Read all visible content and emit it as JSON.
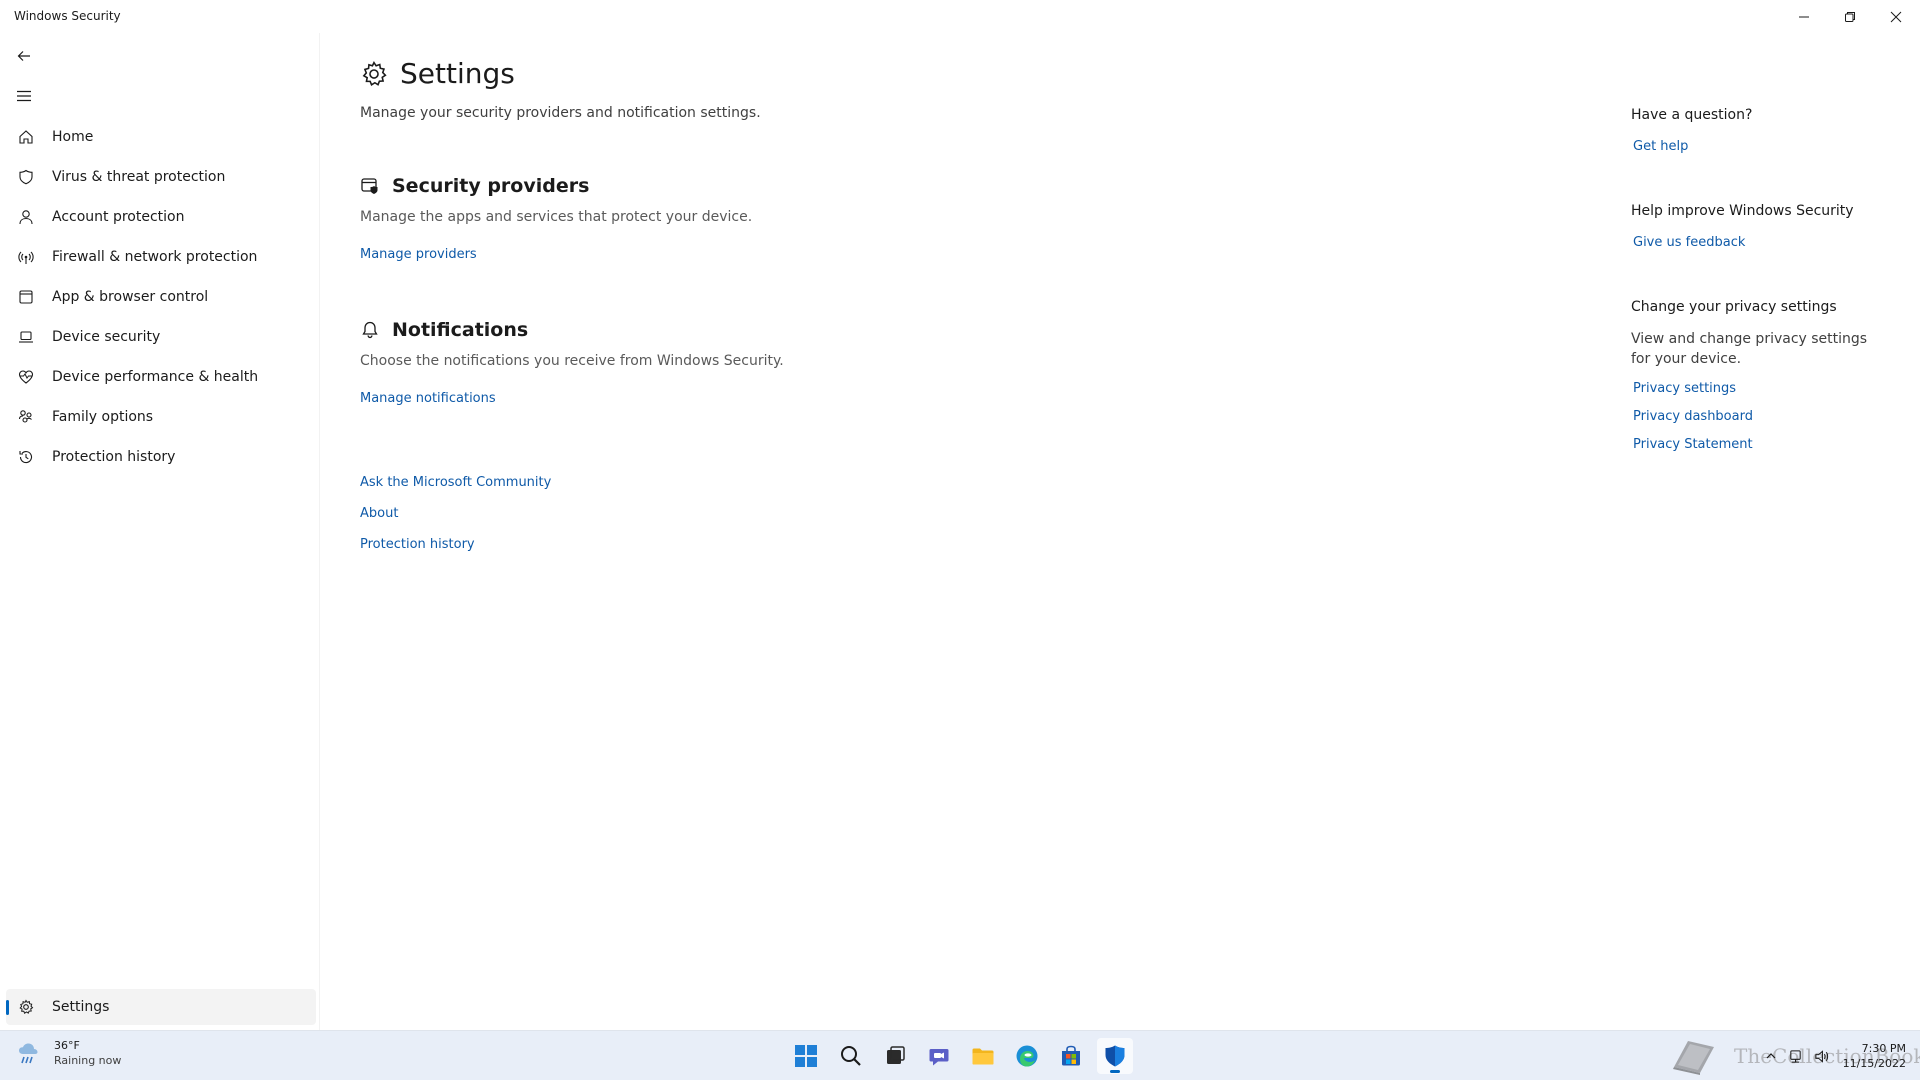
{
  "window": {
    "title": "Windows Security"
  },
  "sidebar": {
    "items": [
      {
        "label": "Home",
        "icon": "home-icon"
      },
      {
        "label": "Virus & threat protection",
        "icon": "shield-icon"
      },
      {
        "label": "Account protection",
        "icon": "person-icon"
      },
      {
        "label": "Firewall & network protection",
        "icon": "wireless-icon"
      },
      {
        "label": "App & browser control",
        "icon": "app-window-icon"
      },
      {
        "label": "Device security",
        "icon": "laptop-icon"
      },
      {
        "label": "Device performance & health",
        "icon": "heart-pulse-icon"
      },
      {
        "label": "Family options",
        "icon": "family-icon"
      },
      {
        "label": "Protection history",
        "icon": "history-icon"
      }
    ],
    "settings_label": "Settings"
  },
  "main": {
    "title": "Settings",
    "subtitle": "Manage your security providers and notification settings.",
    "security_providers": {
      "title": "Security providers",
      "description": "Manage the apps and services that protect your device.",
      "link": "Manage providers"
    },
    "notifications": {
      "title": "Notifications",
      "description": "Choose the notifications you receive from Windows Security.",
      "link": "Manage notifications"
    },
    "links": {
      "community": "Ask the Microsoft Community",
      "about": "About",
      "history": "Protection history"
    }
  },
  "right": {
    "question_head": "Have a question?",
    "get_help": "Get help",
    "improve_head": "Help improve Windows Security",
    "feedback": "Give us feedback",
    "privacy_head": "Change your privacy settings",
    "privacy_desc": "View and change privacy settings for your  device.",
    "privacy_settings": "Privacy settings",
    "privacy_dashboard": "Privacy dashboard",
    "privacy_statement": "Privacy Statement"
  },
  "taskbar": {
    "weather_temp": "36°F",
    "weather_cond": "Raining now",
    "time": "7:30 PM",
    "date": "11/15/2022",
    "watermark": "TheCollectionBook"
  },
  "colors": {
    "accent": "#0067c0",
    "link": "#0f5aa8",
    "taskbar": "#e8eef8"
  }
}
